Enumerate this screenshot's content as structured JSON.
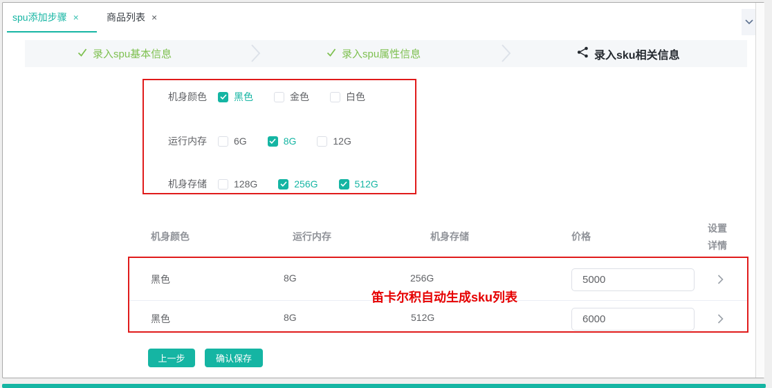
{
  "colors": {
    "accent": "#15b5a3",
    "step_done_green": "#7ec050",
    "highlight_red_border": "#e01a1a",
    "annotation_red": "#e60000"
  },
  "icons": {
    "close": "×"
  },
  "tabbar": {
    "tabs": [
      {
        "label": "spu添加步骤",
        "active": true
      },
      {
        "label": "商品列表",
        "active": false
      }
    ]
  },
  "steps": [
    {
      "label": "录入spu基本信息",
      "status": "done"
    },
    {
      "label": "录入spu属性信息",
      "status": "done"
    },
    {
      "label": "录入sku相关信息",
      "status": "active"
    }
  ],
  "attr_groups": [
    {
      "label": "机身颜色",
      "options": [
        {
          "label": "黑色",
          "checked": true
        },
        {
          "label": "金色",
          "checked": false
        },
        {
          "label": "白色",
          "checked": false
        }
      ]
    },
    {
      "label": "运行内存",
      "options": [
        {
          "label": "6G",
          "checked": false
        },
        {
          "label": "8G",
          "checked": true
        },
        {
          "label": "12G",
          "checked": false
        }
      ]
    },
    {
      "label": "机身存储",
      "options": [
        {
          "label": "128G",
          "checked": false
        },
        {
          "label": "256G",
          "checked": true
        },
        {
          "label": "512G",
          "checked": true
        }
      ]
    }
  ],
  "sku_table": {
    "headers": {
      "color": "机身颜色",
      "ram": "运行内存",
      "storage": "机身存储",
      "price": "价格",
      "action_line1": "设置",
      "action_line2": "详情"
    },
    "rows": [
      {
        "color": "黑色",
        "ram": "8G",
        "storage": "256G",
        "price": "5000"
      },
      {
        "color": "黑色",
        "ram": "8G",
        "storage": "512G",
        "price": "6000"
      }
    ]
  },
  "annotation": "笛卡尔积自动生成sku列表",
  "footer": {
    "prev_label": "上一步",
    "save_label": "确认保存"
  }
}
